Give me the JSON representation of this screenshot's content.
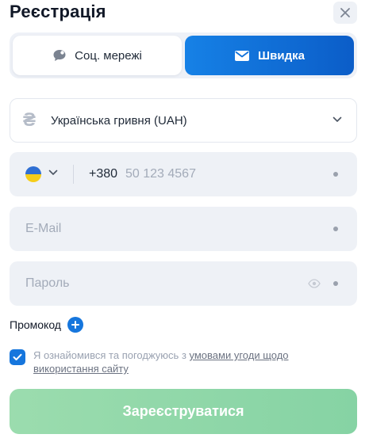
{
  "title": "Реєстрація",
  "close_icon": "close-icon",
  "tabs": [
    {
      "label": "Соц. мережі",
      "icon": "chat-bubble-icon",
      "active": false
    },
    {
      "label": "Швидка",
      "icon": "mail-icon",
      "active": true
    }
  ],
  "currency": {
    "icon_glyph": "₴",
    "label": "Українська гривня (UAH)",
    "icon": "chevron-down-icon"
  },
  "phone": {
    "flag": "ukraine-flag",
    "code": "+380",
    "placeholder": "50 123 4567"
  },
  "email": {
    "placeholder": "E-Mail"
  },
  "password": {
    "placeholder": "Пароль",
    "icon": "eye-icon"
  },
  "promo": {
    "label": "Промокод",
    "icon": "plus-icon"
  },
  "agreement": {
    "checked": true,
    "text": "Я ознайомився та погоджуюсь з ",
    "link": "умовами угоди щодо використання сайту"
  },
  "submit": {
    "label": "Зареєструватися"
  },
  "colors": {
    "accent": "#1676dd",
    "submit": "#8fd8a8",
    "field_bg": "#eef1f6"
  }
}
